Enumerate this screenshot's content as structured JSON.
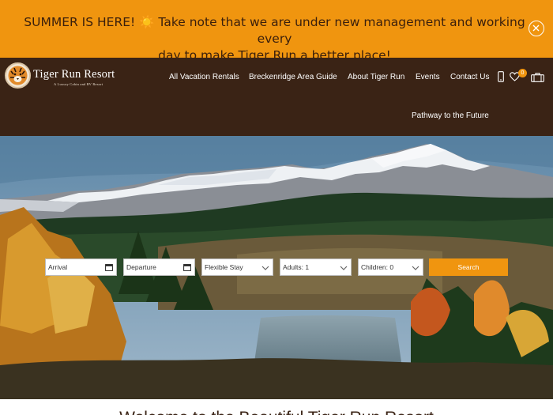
{
  "announcement": {
    "line1": "SUMMER IS HERE! ",
    "sun_glyph": "☀️",
    "line1_rest": " Take note that we are under new management and working every",
    "line2": "day to make Tiger Run a better place!",
    "close_icon": "close-circle-icon"
  },
  "brand": {
    "title": "Tiger Run Resort",
    "subtitle": "A Luxury Cabin and RV Resort",
    "logo_icon": "tiger-head-icon"
  },
  "nav": {
    "items": [
      "All Vacation Rentals",
      "Breckenridge Area Guide",
      "About Tiger Run",
      "Events",
      "Contact Us",
      "Pathway to the Future"
    ],
    "icons": [
      "phone-icon",
      "heart-icon",
      "luggage-icon"
    ],
    "favorites_count": "0"
  },
  "search": {
    "arrival": "Arrival",
    "departure": "Departure",
    "stay": "Flexible Stay",
    "adults": "Adults: 1",
    "children": "Children: 0",
    "button": "Search"
  },
  "welcome": {
    "heading": "Welcome to the Beautiful Tiger Run Resort"
  },
  "colors": {
    "accent": "#f0950f",
    "header_bg": "#3a2315",
    "announce_text": "#3a1f0c"
  }
}
